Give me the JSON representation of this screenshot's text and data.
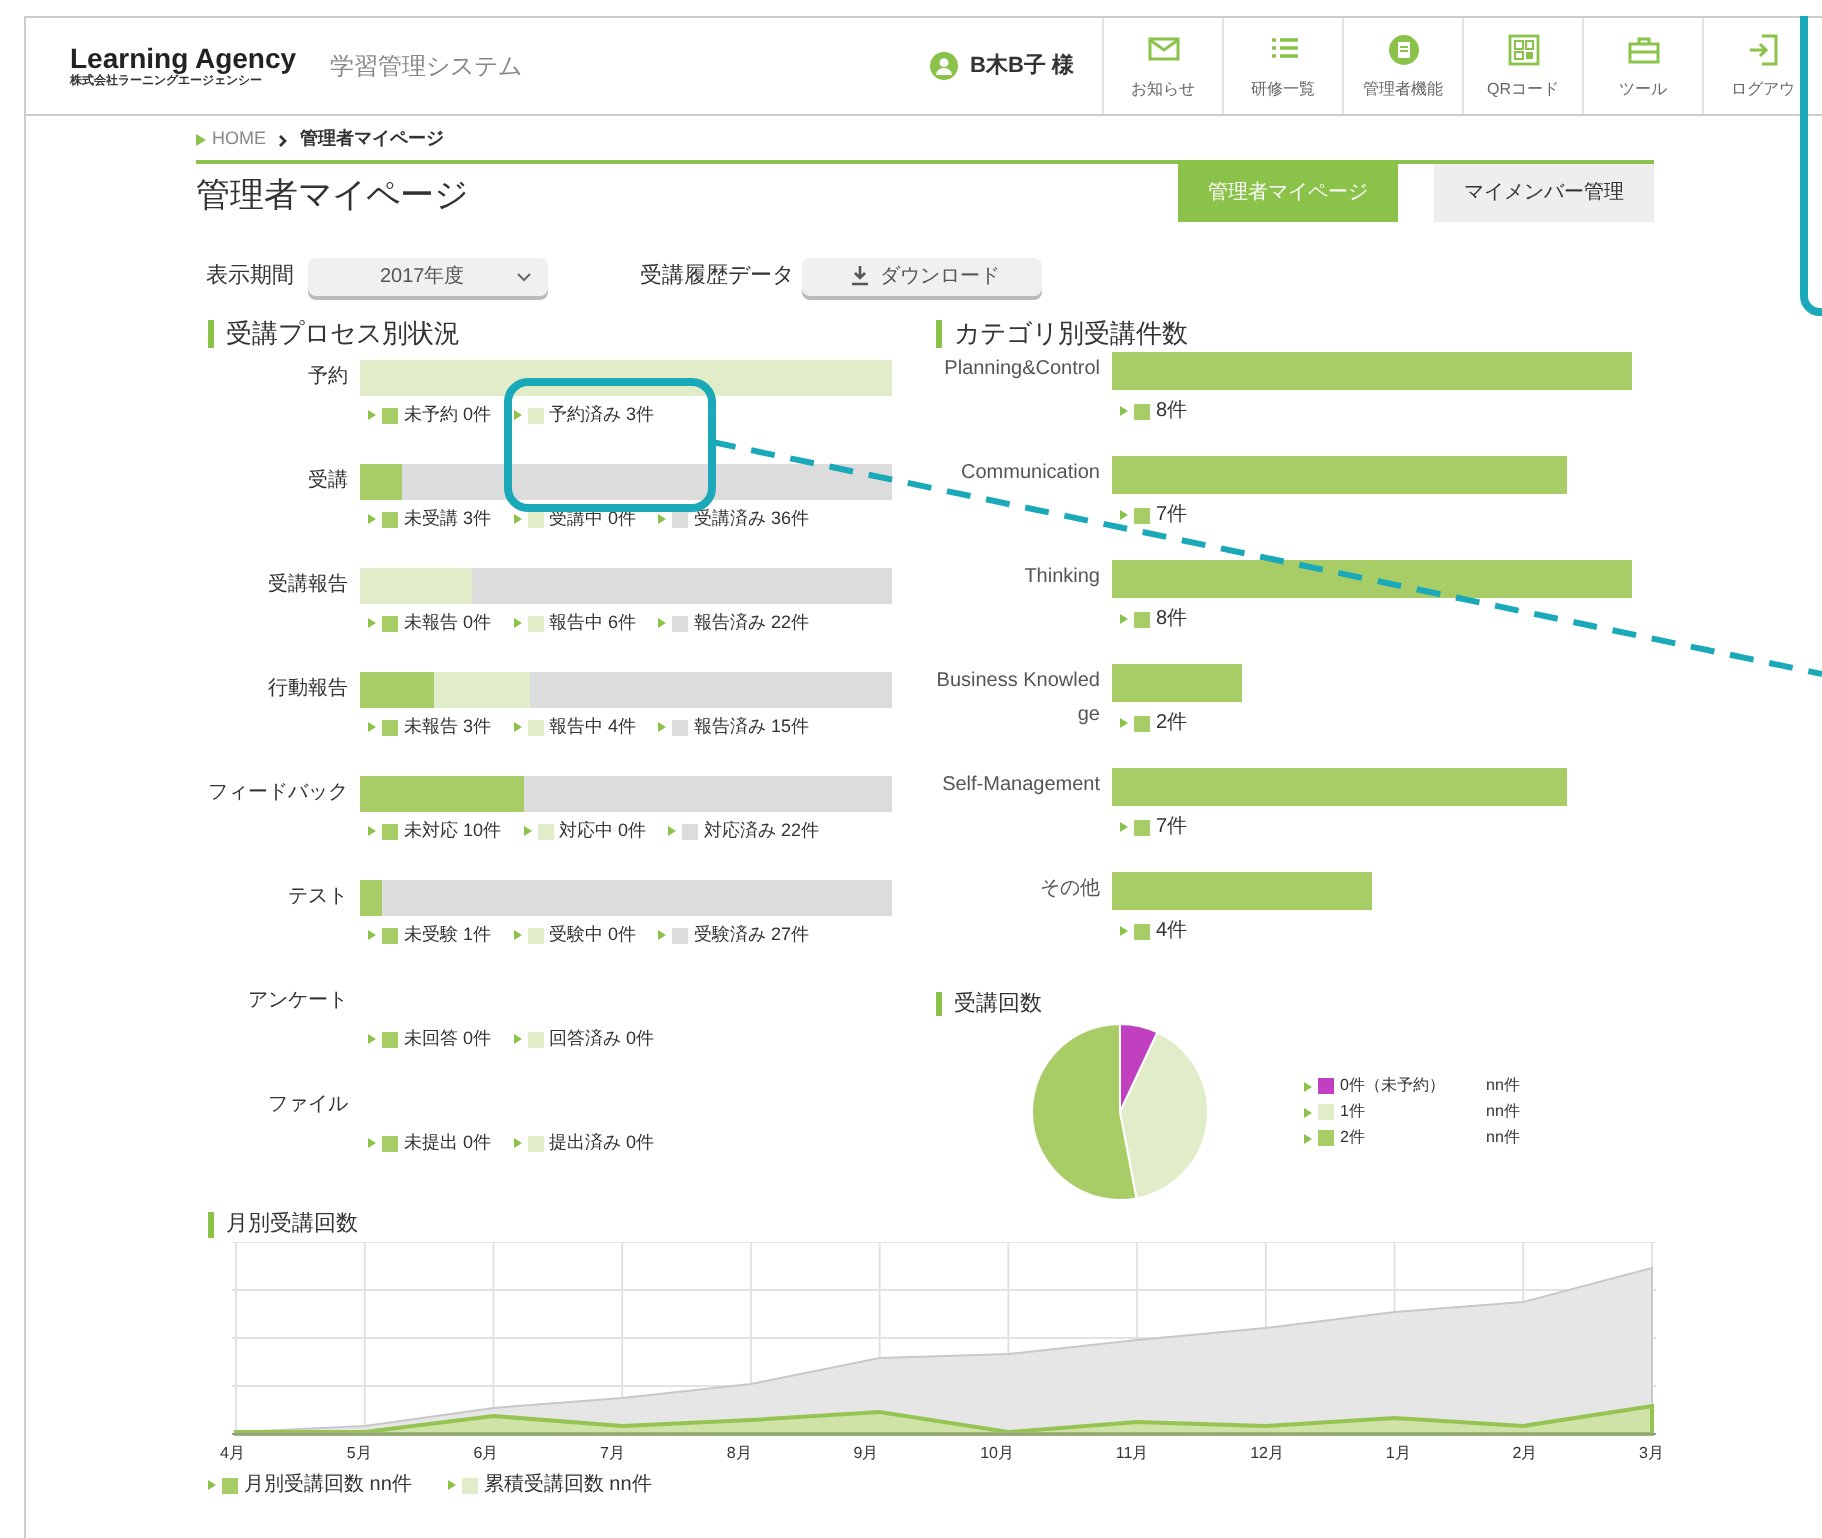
{
  "header": {
    "logo": "Learning Agency",
    "logo_sub": "株式会社ラーニングエージェンシー",
    "system_name": "学習管理システム",
    "user": "B木B子 様",
    "nav": [
      {
        "label": "お知らせ",
        "kind": "mail"
      },
      {
        "label": "研修一覧",
        "kind": "list"
      },
      {
        "label": "管理者機能",
        "kind": "admin"
      },
      {
        "label": "QRコード",
        "kind": "qr"
      },
      {
        "label": "ツール",
        "kind": "tool"
      },
      {
        "label": "ログアウ",
        "kind": "logout"
      }
    ]
  },
  "breadcrumb": [
    "HOME",
    "管理者マイページ"
  ],
  "page_title": "管理者マイページ",
  "tabs": [
    {
      "label": "管理者マイページ",
      "selected": true
    },
    {
      "label": "マイメンバー管理",
      "selected": false
    }
  ],
  "filters": {
    "period_label": "表示期間",
    "period_value": "2017年度",
    "history_label": "受講履歴データ",
    "download": "ダウンロード"
  },
  "process": {
    "title": "受講プロセス別状況",
    "rows": [
      {
        "label": "予約",
        "items": [
          {
            "text": "未予約 0件",
            "color": "#a8cc66"
          },
          {
            "text": "予約済み 3件",
            "color": "#e0edc8"
          }
        ]
      },
      {
        "label": "受講",
        "items": [
          {
            "text": "未受講 3件",
            "color": "#a8cc66"
          },
          {
            "text": "受講中 0件",
            "color": "#e0edc8"
          },
          {
            "text": "受講済み 36件",
            "color": "#dcdcdc"
          }
        ]
      },
      {
        "label": "受講報告",
        "items": [
          {
            "text": "未報告 0件",
            "color": "#a8cc66"
          },
          {
            "text": "報告中 6件",
            "color": "#e0edc8"
          },
          {
            "text": "報告済み 22件",
            "color": "#dcdcdc"
          }
        ]
      },
      {
        "label": "行動報告",
        "items": [
          {
            "text": "未報告 3件",
            "color": "#a8cc66"
          },
          {
            "text": "報告中 4件",
            "color": "#e0edc8"
          },
          {
            "text": "報告済み 15件",
            "color": "#dcdcdc"
          }
        ]
      },
      {
        "label": "フィードバック",
        "items": [
          {
            "text": "未対応 10件",
            "color": "#a8cc66"
          },
          {
            "text": "対応中 0件",
            "color": "#e0edc8"
          },
          {
            "text": "対応済み 22件",
            "color": "#dcdcdc"
          }
        ]
      },
      {
        "label": "テスト",
        "items": [
          {
            "text": "未受験 1件",
            "color": "#a8cc66"
          },
          {
            "text": "受験中 0件",
            "color": "#e0edc8"
          },
          {
            "text": "受験済み 27件",
            "color": "#dcdcdc"
          }
        ]
      },
      {
        "label": "アンケート",
        "items": [
          {
            "text": "未回答 0件",
            "color": "#a8cc66"
          },
          {
            "text": "回答済み 0件",
            "color": "#e0edc8"
          }
        ]
      },
      {
        "label": "ファイル",
        "items": [
          {
            "text": "未提出 0件",
            "color": "#a8cc66"
          },
          {
            "text": "提出済み 0件",
            "color": "#e0edc8"
          }
        ]
      }
    ]
  },
  "category": {
    "chart_data": {
      "type": "bar",
      "orientation": "horizontal",
      "title": "カテゴリ別受講件数",
      "categories": [
        "Planning&Control",
        "Communication",
        "Thinking",
        "Business Knowledge",
        "Self-Management",
        "その他"
      ],
      "values": [
        8,
        7,
        8,
        2,
        7,
        4
      ],
      "value_labels": [
        "8件",
        "7件",
        "8件",
        "2件",
        "7件",
        "4件"
      ]
    }
  },
  "attendance": {
    "title": "受講回数",
    "legend": [
      {
        "label": "0件（未予約）",
        "value": "nn件",
        "color": "#c040c0"
      },
      {
        "label": "1件",
        "value": "nn件",
        "color": "#e0edc8"
      },
      {
        "label": "2件",
        "value": "nn件",
        "color": "#a8cc66"
      }
    ]
  },
  "monthly": {
    "title": "月別受講回数",
    "months": [
      "4月",
      "5月",
      "6月",
      "7月",
      "8月",
      "9月",
      "10月",
      "11月",
      "12月",
      "1月",
      "2月",
      "3月"
    ],
    "legend": [
      {
        "text": "月別受講回数 nn件",
        "color": "#a8cc66"
      },
      {
        "text": "累積受講回数 nn件",
        "color": "#e0edc8"
      }
    ]
  }
}
